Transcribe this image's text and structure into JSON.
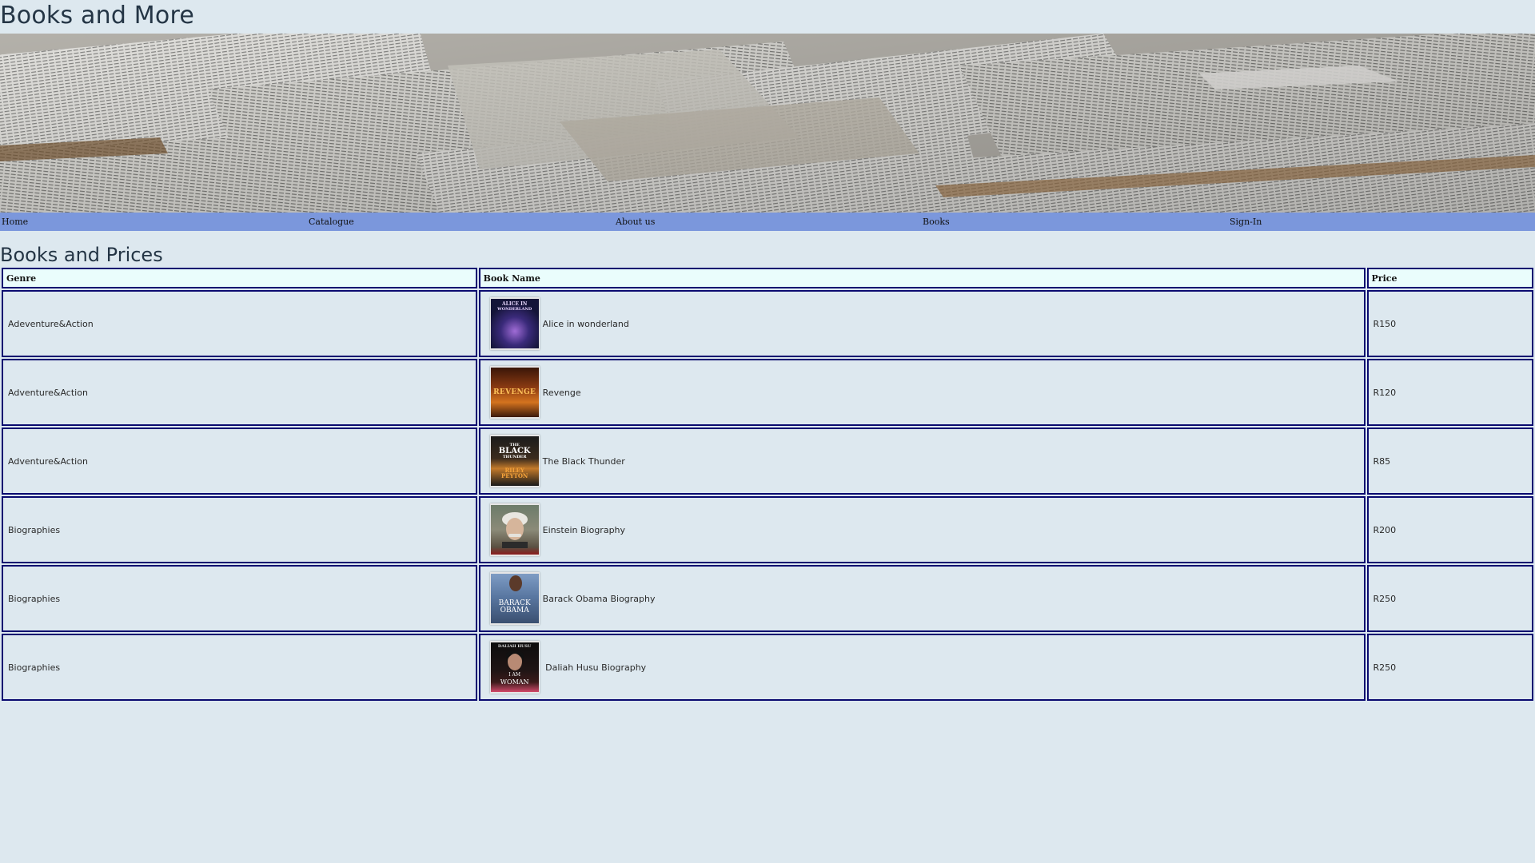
{
  "site": {
    "title": "Books and More"
  },
  "hero": {
    "image": "open-books-pages-banner"
  },
  "nav": {
    "items": [
      {
        "label": "Home"
      },
      {
        "label": "Catalogue"
      },
      {
        "label": "About us"
      },
      {
        "label": "Books"
      },
      {
        "label": "Sign-In"
      }
    ]
  },
  "main": {
    "title": "Books and Prices",
    "table": {
      "headers": {
        "genre": "Genre",
        "book_name": "Book Name",
        "price": "Price"
      },
      "rows": [
        {
          "genre": "Adeventure&Action",
          "book_name": "Alice in wonderland",
          "price": "R150",
          "cover_icon": "alice-cover",
          "cover_text": [
            "ALICE IN",
            "WONDERLAND"
          ]
        },
        {
          "genre": "Adventure&Action",
          "book_name": "Revenge",
          "price": "R120",
          "cover_icon": "revenge-cover",
          "cover_text": [
            "REVENGE"
          ]
        },
        {
          "genre": "Adventure&Action",
          "book_name": "The Black Thunder",
          "price": "R85",
          "cover_icon": "black-thunder-cover",
          "cover_text": [
            "THE",
            "BLACK",
            "THUNDER",
            "RILEY",
            "PEYTON"
          ]
        },
        {
          "genre": "Biographies",
          "book_name": "Einstein Biography",
          "price": "R200",
          "cover_icon": "einstein-cover",
          "cover_text": []
        },
        {
          "genre": "Biographies",
          "book_name": "Barack Obama Biography",
          "price": "R250",
          "cover_icon": "obama-cover",
          "cover_text": [
            "BARACK",
            "OBAMA"
          ]
        },
        {
          "genre": "Biographies",
          "book_name": " Daliah Husu Biography",
          "price": "R250",
          "cover_icon": "daliah-cover",
          "cover_text": [
            "DALIAH HUSU",
            "I AM",
            "WOMAN"
          ]
        }
      ]
    }
  },
  "colors": {
    "page_bg": "#dde8ef",
    "nav_bg": "#7b97dc",
    "header_bg": "#eafdfc",
    "border": "#0a0a70"
  }
}
